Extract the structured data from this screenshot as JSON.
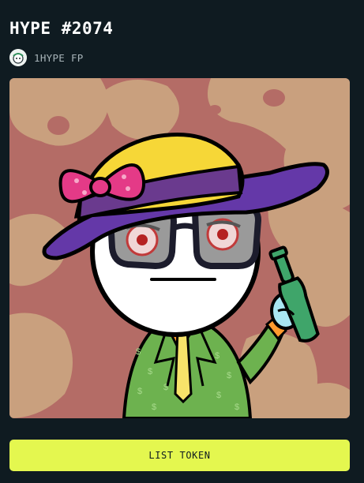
{
  "token": {
    "title": "HYPE #2074",
    "image_alt": "HYPE #2074 artwork"
  },
  "collection": {
    "label": "1HYPE FP",
    "avatar_icon": "collection-avatar-icon"
  },
  "actions": {
    "list_label": "LIST TOKEN"
  },
  "colors": {
    "background": "#0f1b21",
    "accent": "#e4f74f",
    "muted_text": "#a7b3b8"
  }
}
